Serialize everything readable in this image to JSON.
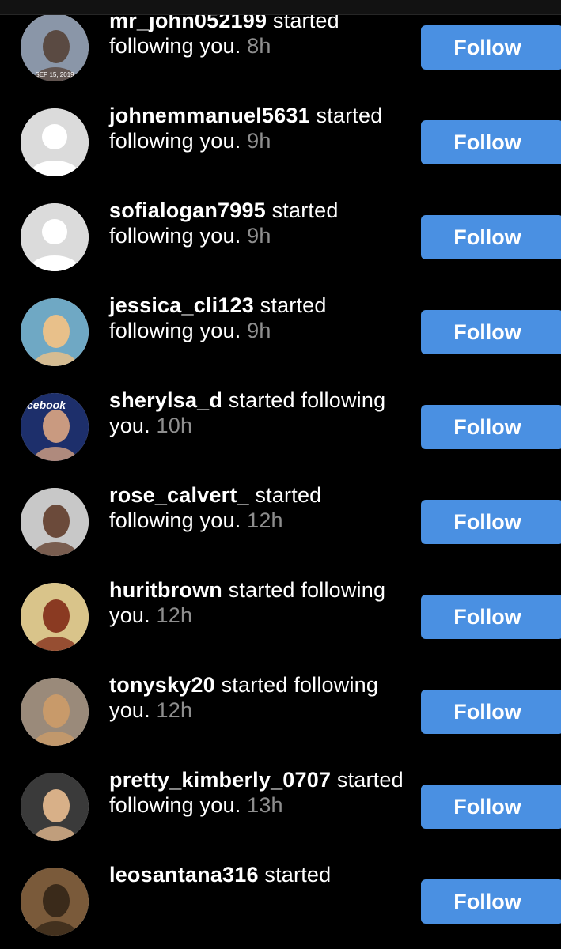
{
  "activity": {
    "items": [
      {
        "username": "mr_john052199",
        "message": " started following you.",
        "time": "8h",
        "follow_label": "Follow",
        "avatar": "photo",
        "avatar_caption": "SEP 15, 2019",
        "avatar_colors": [
          "#8a96a8",
          "#5a4a42"
        ]
      },
      {
        "username": "johnemmanuel5631",
        "message": " started following you.",
        "time": "9h",
        "follow_label": "Follow",
        "avatar": "default"
      },
      {
        "username": "sofialogan7995",
        "message": " started following you.",
        "time": "9h",
        "follow_label": "Follow",
        "avatar": "default"
      },
      {
        "username": "jessica_cli123",
        "message": " started following you.",
        "time": "9h",
        "follow_label": "Follow",
        "avatar": "photo",
        "avatar_colors": [
          "#6fa8c4",
          "#e8c08a"
        ]
      },
      {
        "username": "sherylsa_d",
        "message": " started following you.",
        "time": "10h",
        "follow_label": "Follow",
        "avatar": "photo",
        "avatar_caption": "cebook",
        "avatar_colors": [
          "#1d2f6b",
          "#c99a80"
        ]
      },
      {
        "username": "rose_calvert_",
        "message": " started following you.",
        "time": "12h",
        "follow_label": "Follow",
        "avatar": "photo",
        "avatar_colors": [
          "#c8c8c8",
          "#6b4a3a"
        ]
      },
      {
        "username": "huritbrown",
        "message": " started following you.",
        "time": "12h",
        "follow_label": "Follow",
        "avatar": "photo",
        "avatar_colors": [
          "#d9c48a",
          "#8a3a22"
        ]
      },
      {
        "username": "tonysky20",
        "message": " started following you.",
        "time": "12h",
        "follow_label": "Follow",
        "avatar": "photo",
        "avatar_colors": [
          "#9a8a7a",
          "#c89a6a"
        ]
      },
      {
        "username": "pretty_kimberly_0707",
        "message": " started following you.",
        "time": "13h",
        "follow_label": "Follow",
        "avatar": "photo",
        "avatar_colors": [
          "#3a3a3a",
          "#d8b088"
        ]
      },
      {
        "username": "leosantana316",
        "message": " started",
        "time": "",
        "follow_label": "Follow",
        "avatar": "photo",
        "avatar_colors": [
          "#7a5a3a",
          "#3a2a1a"
        ]
      }
    ]
  }
}
